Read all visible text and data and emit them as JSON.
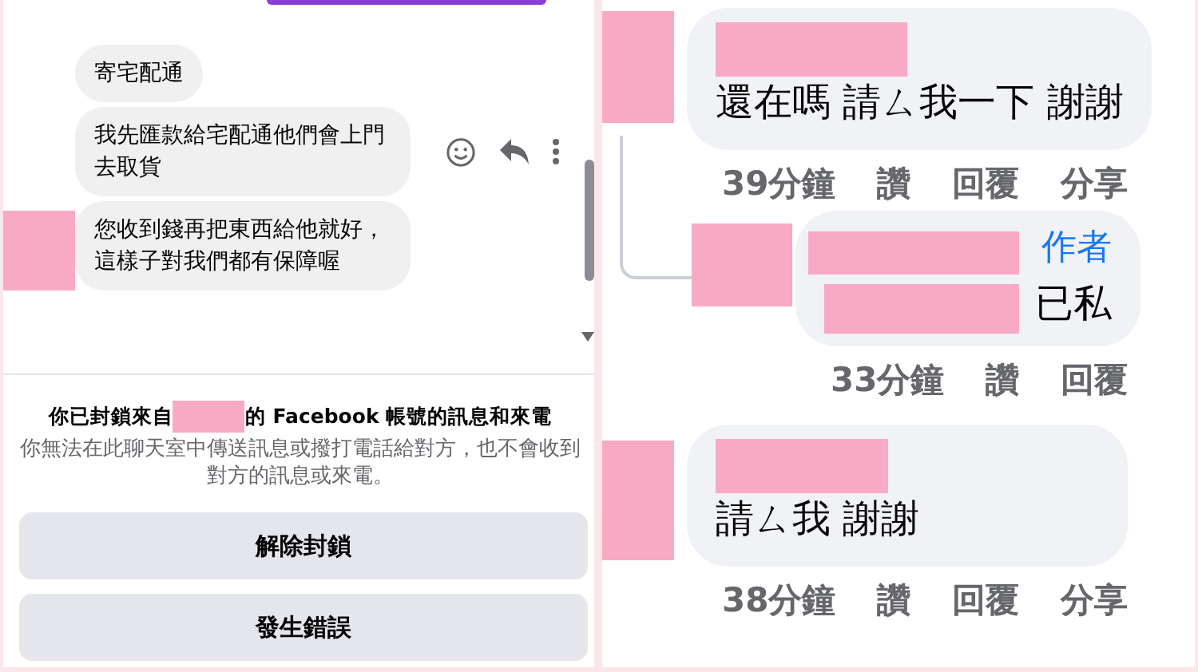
{
  "messenger": {
    "messages": [
      {
        "text": "寄宅配通"
      },
      {
        "text": "我先匯款給宅配通他們會上門去取貨",
        "hover_actions": true
      },
      {
        "text": "您收到錢再把東西給他就好，這樣子對我們都有保障喔",
        "avatar": true
      }
    ],
    "block_notice": {
      "title_before": "你已封鎖來自",
      "title_after": "的 Facebook 帳號的訊息和來電",
      "body": "你無法在此聊天室中傳送訊息或撥打電話給對方，也不會收到對方的訊息或來電。",
      "buttons": [
        "解除封鎖",
        "發生錯誤"
      ]
    }
  },
  "comments": [
    {
      "text": "還在嗎 請ㄙ我一下 謝謝",
      "time": "39分鐘",
      "actions": [
        "讚",
        "回覆",
        "分享"
      ],
      "children": [
        {
          "text": "已私",
          "badge": "作者",
          "time": "33分鐘",
          "actions": [
            "讚",
            "回覆"
          ]
        }
      ]
    },
    {
      "text": "請ㄙ我 謝謝",
      "time": "38分鐘",
      "actions": [
        "讚",
        "回覆",
        "分享"
      ]
    }
  ]
}
